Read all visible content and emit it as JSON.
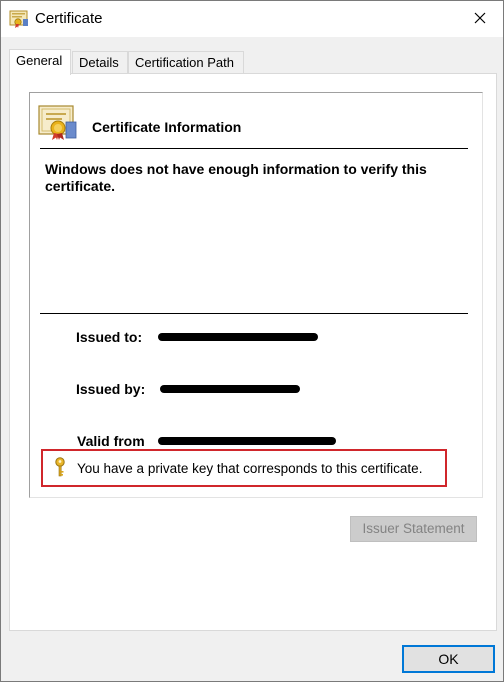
{
  "window": {
    "title": "Certificate",
    "close_glyph": "✕"
  },
  "tabs": [
    {
      "label": "General",
      "active": true
    },
    {
      "label": "Details",
      "active": false
    },
    {
      "label": "Certification Path",
      "active": false
    }
  ],
  "info": {
    "heading": "Certificate Information",
    "warning": "Windows does not have enough information to verify this certificate.",
    "issued_to_label": "Issued to:",
    "issued_by_label": "Issued by:",
    "valid_from_label": "Valid from",
    "private_key_message": "You have a private key that corresponds to this certificate."
  },
  "buttons": {
    "issuer_statement": "Issuer Statement",
    "ok": "OK"
  },
  "icons": {
    "window": "certificate-icon",
    "info": "certificate-image-icon",
    "key": "key-icon",
    "close": "close-icon"
  },
  "colors": {
    "highlight_border": "#d0262b",
    "ok_border": "#0078d7",
    "disabled_text": "#838383"
  }
}
